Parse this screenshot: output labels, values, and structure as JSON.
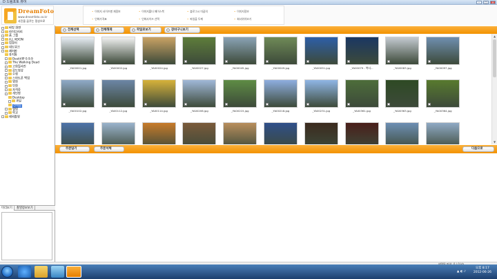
{
  "window": {
    "title": "D 드림포토 뷰어"
  },
  "logo": {
    "brand": "DreamFoto",
    "url": "www.dreamfoto.co.kr",
    "slogan": "사진을 꿈꾸는 정성으로"
  },
  "menu": {
    "items": [
      "이미지 사이즈별 재정보",
      "이미지폴더 페이스북",
      "블로그시 미꿈의",
      "이미지정보",
      "인화가격표",
      "인화사이즈 선택",
      "파일을 두께",
      "회사위치보기"
    ]
  },
  "toolbar": {
    "buttons": [
      "전체선택",
      "전체해제",
      "파일로보기",
      "장바구니보기"
    ]
  },
  "tree": {
    "items": [
      "바탕 화면",
      "라이브러리",
      "홈 그룹",
      "A.J. KOON",
      "컴퓨터",
      "네트워크",
      "제어판",
      "휴지통",
      "DeskVIP 0.9.9",
      "The Walking Dead",
      "고화질사진",
      "감도영상",
      "수정",
      "스마트폰 백업",
      "영화",
      "인화",
      "자격증",
      "개인정",
      "Desktop",
      "과일",
      "선택됨",
      "앨범",
      "학교",
      "해외촬영"
    ]
  },
  "tabs": [
    "미리보기",
    "촬영정보보기"
  ],
  "gallery": {
    "items": [
      "_YA00001.jpg",
      "_YA00002.jpg",
      "_YA00024.jpg",
      "_YA00027.jpg",
      "_YA00045.jpg",
      "_YA00049.jpg",
      "_YA00051.jpg",
      "_YA00079 - 복사...",
      "_YA00083.jpg",
      "_YA00097.jpg",
      "_YA00102.jpg",
      "_YA00112.jpg",
      "_YA00114.jpg",
      "_YA00206.jpg",
      "_YA00215.jpg",
      "_YA00218.jpg",
      "_YA00231.jpg",
      "_YA00361.jpg",
      "_YA00363.jpg",
      "_YA00364.jpg",
      "",
      "",
      "",
      "",
      "",
      "",
      "",
      "",
      "",
      ""
    ],
    "colors": [
      "#e8eef5",
      "#f2f2f2",
      "#c9a264",
      "#5e7d3a",
      "#8aa3b5",
      "#6f8a57",
      "#2d5fa8",
      "#1a3763",
      "#c4cad1",
      "#6f8fb0",
      "#8faac8",
      "#6c86a6",
      "#d7b23a",
      "#a0b8d8",
      "#5e8c44",
      "#8eaee0",
      "#8fb6e6",
      "#4d6d3a",
      "#2e4a24",
      "#587a2e",
      "#4d73a8",
      "#9ab3cc",
      "#c77b2a",
      "#7a5a3a",
      "#b88e5c",
      "#2f4f8a",
      "#3b2a1e",
      "#4a1f1a",
      "#6d8fb3",
      "#8fa9c4"
    ]
  },
  "bottombar": {
    "prev": "주문담기",
    "detail": "주문서체",
    "next": "다음으로"
  },
  "status": {
    "text": "선택된 파일: 0 / 0 kb"
  },
  "clock": {
    "time": "오후 8:17",
    "date": "2012-06-26"
  }
}
